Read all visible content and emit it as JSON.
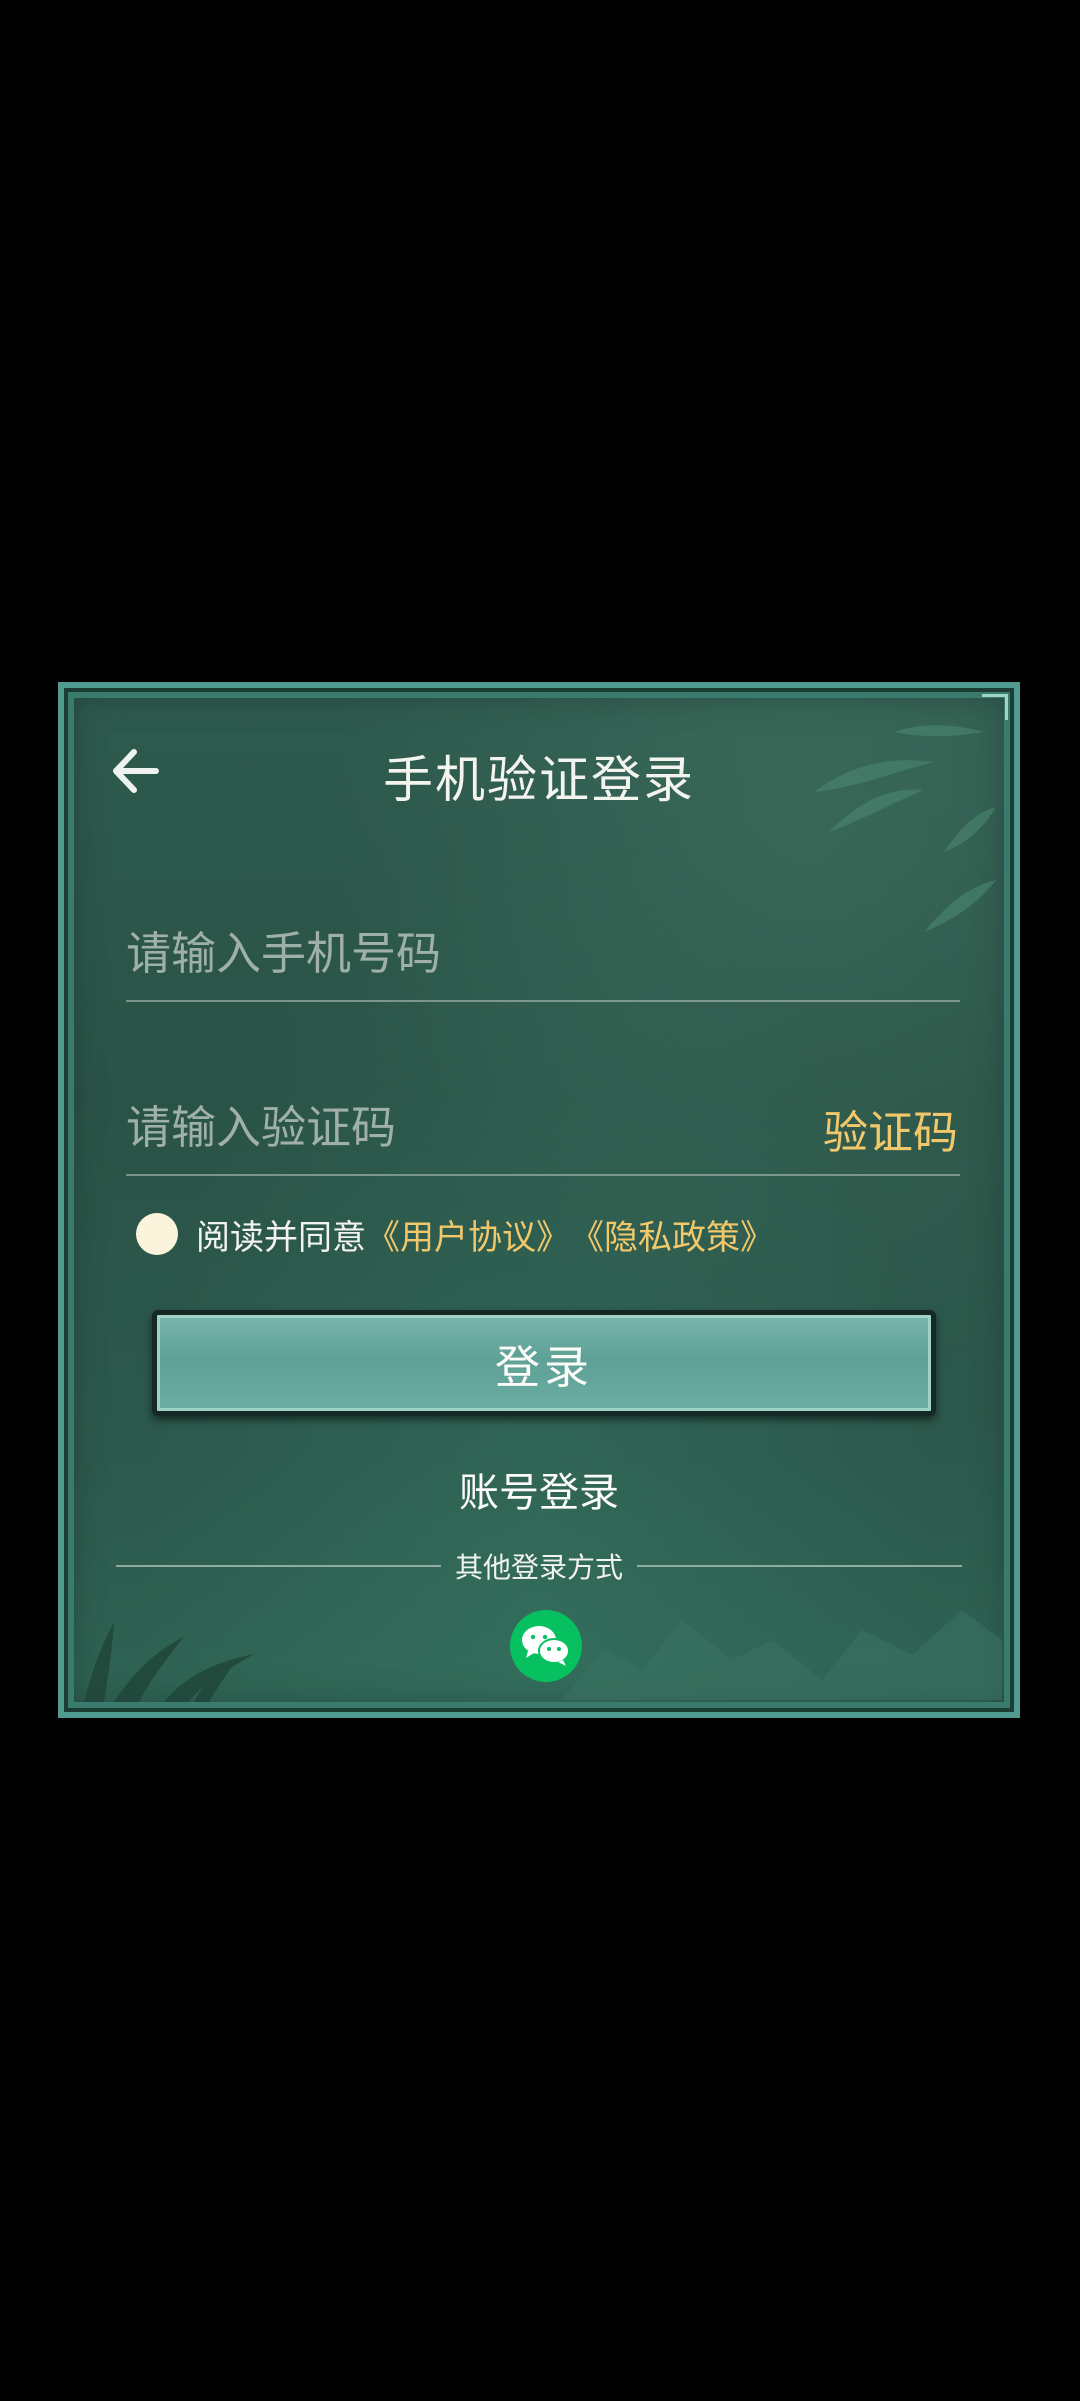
{
  "dialog": {
    "title": "手机验证登录",
    "phone_placeholder": "请输入手机号码",
    "code_placeholder": "请输入验证码",
    "code_button": "验证码",
    "agree_prefix": "阅读并同意",
    "user_agreement": "《用户协议》",
    "privacy_policy": "《隐私政策》",
    "login_button": "登录",
    "account_login": "账号登录",
    "other_methods": "其他登录方式"
  },
  "icons": {
    "back": "back-arrow-icon",
    "wechat": "wechat-icon"
  },
  "colors": {
    "accent_gold": "#f2c86a",
    "panel_green": "#2c594c",
    "button_teal": "#6aaca2",
    "wechat_green": "#07c160"
  }
}
